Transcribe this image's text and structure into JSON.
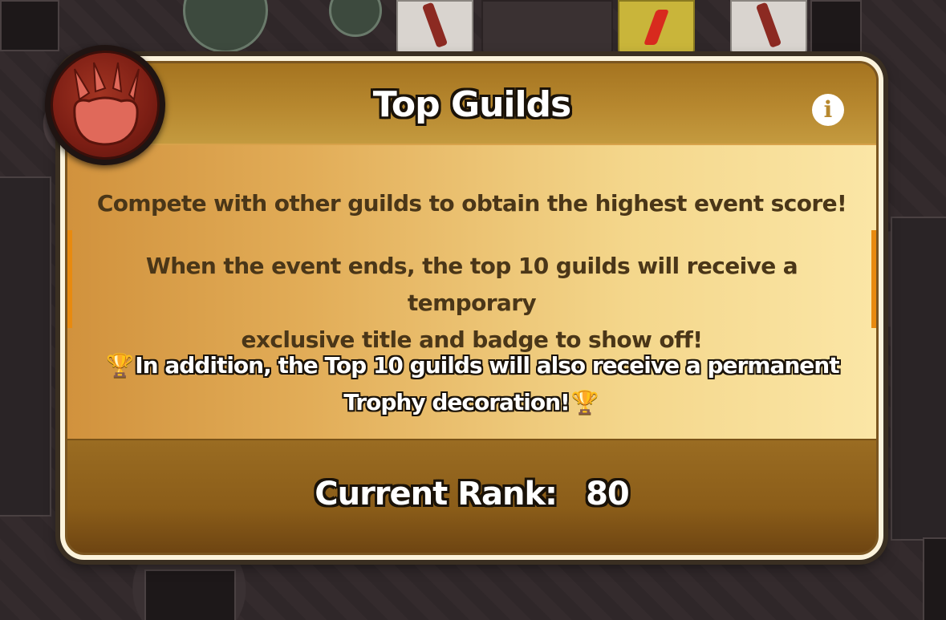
{
  "dialog": {
    "title": "Top Guilds",
    "info_icon": "info-icon",
    "badge_icon": "paw-claw-icon",
    "paragraphs": {
      "p1": "Compete with other guilds to obtain the highest event score!",
      "p2_line1": "When the event ends, the top 10 guilds will receive a temporary",
      "p2_line2": "exclusive title and badge to show off!",
      "p3_line1": "In addition, the Top 10 guilds will also receive a permanent",
      "p3_line2": "Trophy decoration!"
    },
    "trophy_glyph": "🏆",
    "footer": {
      "rank_label": "Current Rank:",
      "rank_value": "80"
    }
  },
  "colors": {
    "header": "#b7882f",
    "body_light": "#fbe6a6",
    "body_dark": "#d1923d",
    "footer": "#8b5d19",
    "badge": "#7c1e14",
    "claw": "#e0695a",
    "text_dark": "#4a3618"
  }
}
